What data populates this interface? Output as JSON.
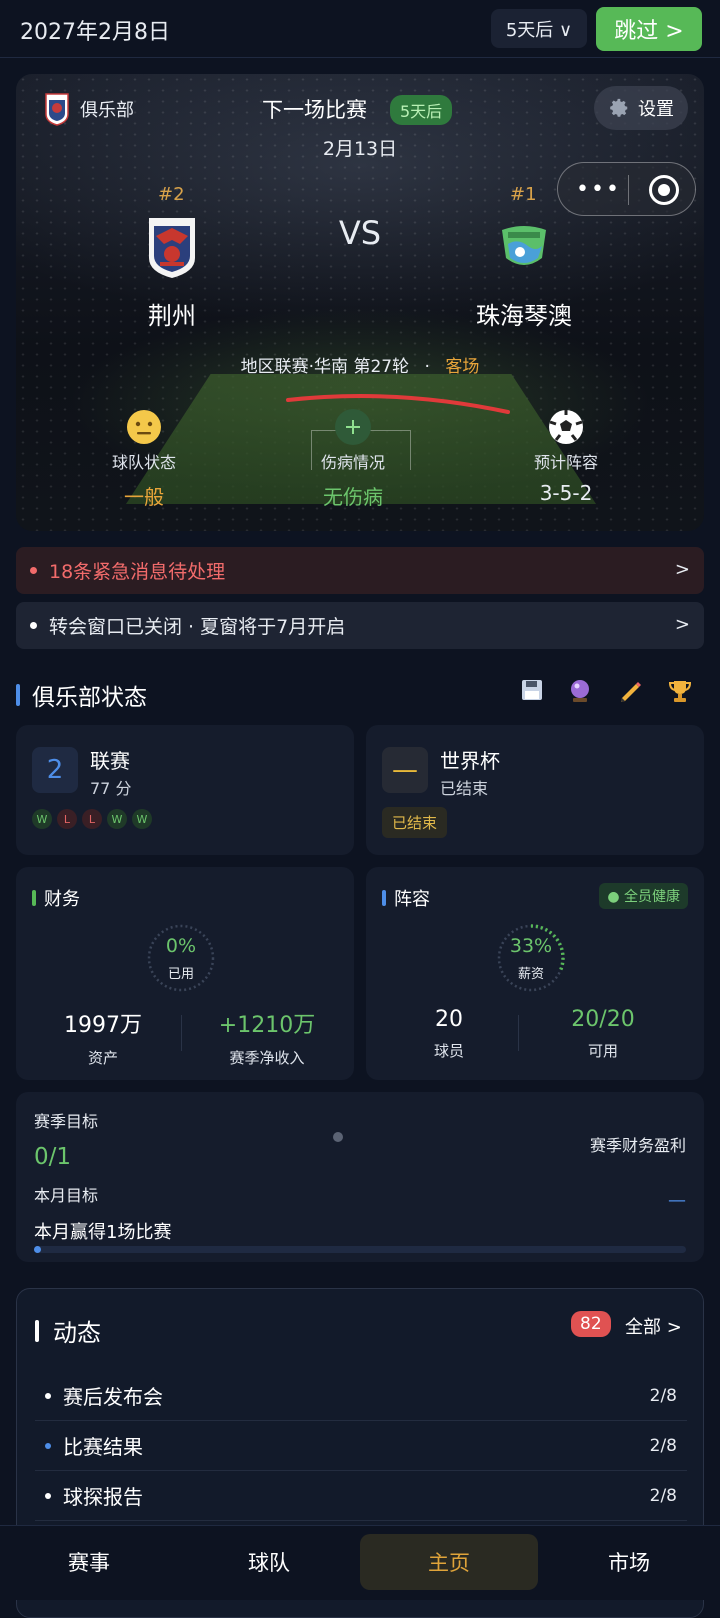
{
  "topbar": {
    "date": "2027年2月8日",
    "speed": "5天后 ∨",
    "skip": "跳过 >"
  },
  "match": {
    "club_label": "俱乐部",
    "next_title": "下一场比赛",
    "next_badge": "5天后",
    "date": "2月13日",
    "settings": "设置",
    "capsule_more": "•••",
    "home": {
      "rank": "#2",
      "name": "荆州"
    },
    "away": {
      "rank": "#1",
      "name": "珠海琴澳"
    },
    "vs": "VS",
    "league": "地区联赛·华南 第27轮",
    "sep": "·",
    "venue": "客场",
    "stats": [
      {
        "label": "球队状态",
        "value": "一般",
        "value_color": "#e8a53a"
      },
      {
        "label": "伤病情况",
        "value": "无伤病",
        "value_color": "#6cc56c"
      },
      {
        "label": "预计阵容",
        "value": "3-5-2",
        "value_color": "#e8ecf2"
      }
    ]
  },
  "alerts": {
    "urgent": "18条紧急消息待处理",
    "info": "转会窗口已关闭 · 夏窗将于7月开启",
    "arrow": ">"
  },
  "club_status": {
    "title": "俱乐部状态",
    "icons": [
      "save-icon",
      "crystal-ball-icon",
      "pencil-icon",
      "trophy-icon"
    ],
    "league": {
      "rank": "2",
      "title": "联赛",
      "points": "77 分",
      "form": [
        "W",
        "L",
        "L",
        "W",
        "W"
      ]
    },
    "worldcup": {
      "dash": "—",
      "title": "世界杯",
      "status": "已结束",
      "tag": "已结束"
    },
    "finance": {
      "title": "财务",
      "ring_pct": "0%",
      "ring_label": "已用",
      "ring_value": 0,
      "assets_value": "1997万",
      "assets_label": "资产",
      "income_value": "+1210万",
      "income_label": "赛季净收入"
    },
    "squad": {
      "title": "阵容",
      "health": "全员健康",
      "ring_pct": "33%",
      "ring_label": "薪资",
      "ring_value": 0.33,
      "players_value": "20",
      "players_label": "球员",
      "avail_value": "20/20",
      "avail_label": "可用"
    },
    "goals": {
      "season_label": "赛季目标",
      "season_progress": "0/1",
      "season_goal": "赛季财务盈利",
      "month_label": "本月目标",
      "month_task": "本月赢得1场比赛",
      "month_dash": "—",
      "month_progress": 0
    }
  },
  "activity": {
    "title": "动态",
    "count": "82",
    "all": "全部 >",
    "items": [
      {
        "text": "赛后发布会",
        "date": "2/8",
        "dot": "#ffffff"
      },
      {
        "text": "比赛结果",
        "date": "2/8",
        "dot": "#4e8ee8"
      },
      {
        "text": "球探报告",
        "date": "2/8",
        "dot": "#ffffff"
      }
    ]
  },
  "nav": [
    "赛事",
    "球队",
    "主页",
    "市场"
  ],
  "colors": {
    "accent_green": "#57b957",
    "accent_blue": "#4e8ee8",
    "accent_orange": "#e0a43a",
    "danger": "#f26b6b"
  }
}
